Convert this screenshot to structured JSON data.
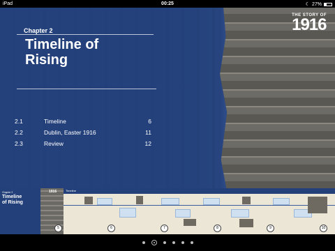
{
  "status": {
    "device": "iPad",
    "time": "00:25",
    "battery": "27%",
    "battery_fraction": 0.27
  },
  "page": {
    "logo_small": "THE STORY OF",
    "logo_big": "1916",
    "chapter_label": "Chapter 2",
    "chapter_title_line1": "Timeline of",
    "chapter_title_line2": "Rising",
    "toc": [
      {
        "num": "2.1",
        "label": "Timeline",
        "page": "6"
      },
      {
        "num": "2.2",
        "label": "Dublin, Easter 1916",
        "page": "11"
      },
      {
        "num": "2.3",
        "label": "Review",
        "page": "12"
      }
    ]
  },
  "thumbnails": {
    "chapter_small": "Chapter 2",
    "chapter_title_line1": "Timeline",
    "chapter_title_line2": "of Rising",
    "timeline_header": "Timeline",
    "logo": "1916",
    "page_numbers": [
      "5",
      "6",
      "7",
      "8",
      "9",
      "10"
    ]
  },
  "pager": {
    "count": 6,
    "current_index": 1
  }
}
